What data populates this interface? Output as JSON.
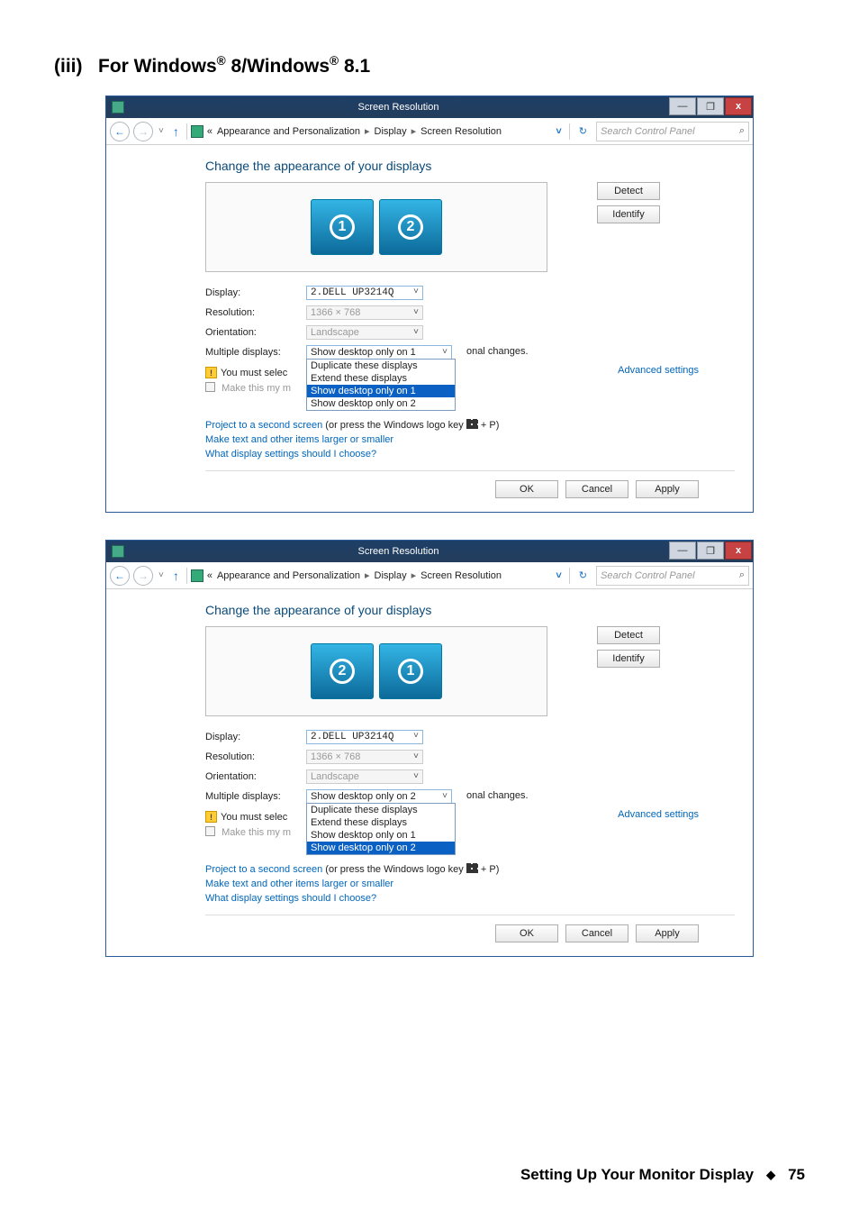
{
  "section": {
    "number": "(iii)",
    "title_prefix": "For Windows",
    "title_suffix_1": " 8/Windows",
    "title_suffix_2": " 8.1",
    "reg_mark": "®"
  },
  "window_common": {
    "title": "Screen Resolution",
    "min": "—",
    "max": "❐",
    "close": "x",
    "nav_back": "←",
    "nav_fwd": "→",
    "nav_up": "↑",
    "bc_guillemet": "«",
    "bc_1": "Appearance and Personalization",
    "bc_sep": "▸",
    "bc_2": "Display",
    "bc_3": "Screen Resolution",
    "bc_drop": "˅",
    "refresh": "↻",
    "search_placeholder": "Search Control Panel",
    "magnify": "⌕",
    "heading": "Change the appearance of your displays",
    "btn_detect": "Detect",
    "btn_identify": "Identify",
    "label_display": "Display:",
    "label_resolution": "Resolution:",
    "label_orientation": "Orientation:",
    "label_multiple": "Multiple displays:",
    "val_display": "2.DELL UP3214Q",
    "val_resolution": "1366 × 768",
    "val_orientation": "Landscape",
    "opt_dup": "Duplicate these displays",
    "opt_ext": "Extend these displays",
    "opt_s1": "Show desktop only on 1",
    "opt_s2": "Show desktop only on 2",
    "warn_text_1": "You must selec",
    "warn_text_2": "onal changes.",
    "make_main": "Make this my m",
    "adv": "Advanced settings",
    "link_project_1": "Project to a second screen",
    "link_project_2": " (or press the Windows logo key ",
    "link_project_3": " + P)",
    "link_items": "Make text and other items larger or smaller",
    "link_help": "What display settings should I choose?",
    "btn_ok": "OK",
    "btn_cancel": "Cancel",
    "btn_apply": "Apply"
  },
  "window1": {
    "monitors": [
      "1",
      "2"
    ],
    "dd_selected": "Show desktop only on 1",
    "dd_highlight_index": 2
  },
  "window2": {
    "monitors": [
      "2",
      "1"
    ],
    "dd_selected": "Show desktop only on 2",
    "dd_highlight_index": 3
  },
  "footer": {
    "text": "Setting Up Your Monitor Display",
    "diamond": "◆",
    "page": "75"
  }
}
